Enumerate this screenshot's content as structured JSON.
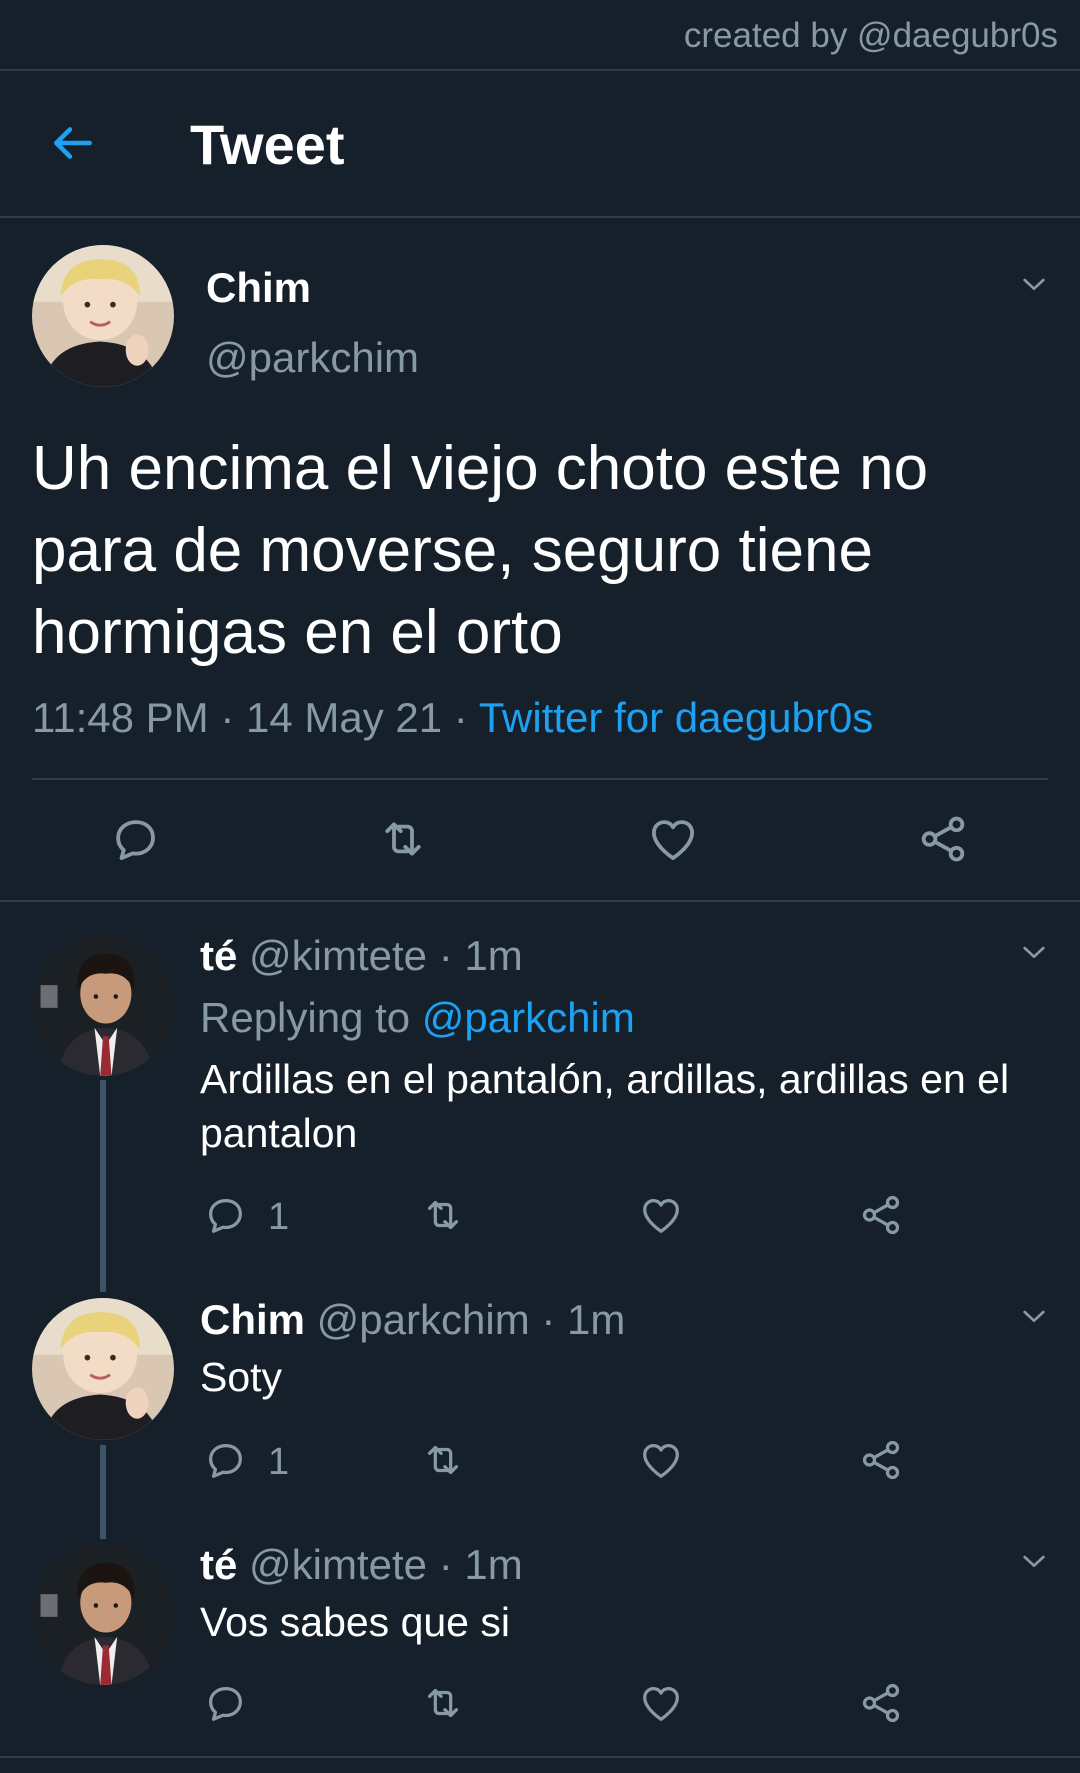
{
  "credit": "created by @daegubr0s",
  "header": {
    "title": "Tweet"
  },
  "main_tweet": {
    "name": "Chim",
    "handle": "@parkchim",
    "text": "Uh encima el viejo choto este no para de moverse, seguro tiene hormigas en el orto",
    "time": "11:48 PM",
    "date": "14 May 21",
    "separator": "·",
    "source": "Twitter for daegubr0s"
  },
  "replies": [
    {
      "name": "té",
      "handle": "@kimtete",
      "time": "1m",
      "replying_label": "Replying to",
      "replying_to": "@parkchim",
      "text": "Ardillas en el pantalón, ardillas, ardillas en el pantalon",
      "reply_count": "1"
    },
    {
      "name": "Chim",
      "handle": "@parkchim",
      "time": "1m",
      "text": "Soty",
      "reply_count": "1"
    },
    {
      "name": "té",
      "handle": "@kimtete",
      "time": "1m",
      "text": "Vos sabes que si"
    }
  ],
  "icons": {
    "back": "arrow-left-icon",
    "menu": "chevron-down-icon",
    "reply": "speech-bubble-icon",
    "retweet": "retweet-icon",
    "like": "heart-icon",
    "share": "share-icon"
  },
  "colors": {
    "background": "#15202b",
    "accent": "#1da1f2",
    "secondary_text": "#8899a6",
    "divider": "#2f3d4a"
  }
}
